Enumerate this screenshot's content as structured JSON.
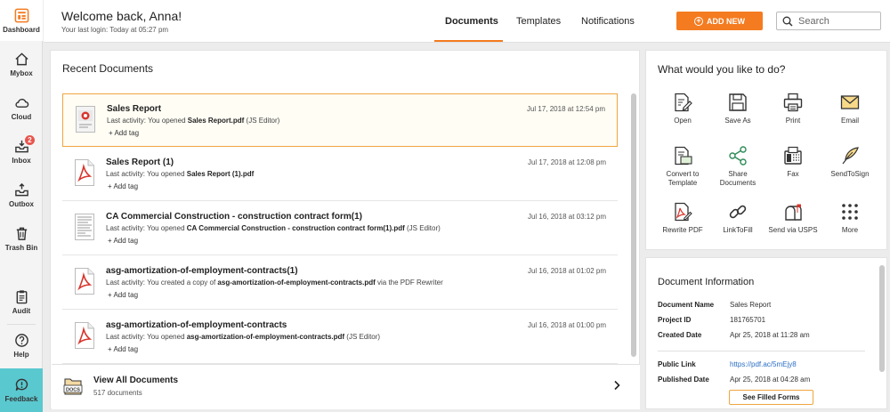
{
  "sidebar": {
    "items": [
      {
        "label": "Dashboard",
        "icon": "dashboard-icon"
      },
      {
        "label": "Mybox",
        "icon": "home-icon"
      },
      {
        "label": "Cloud",
        "icon": "cloud-icon"
      },
      {
        "label": "Inbox",
        "icon": "inbox-icon",
        "badge": "2"
      },
      {
        "label": "Outbox",
        "icon": "outbox-icon"
      },
      {
        "label": "Trash Bin",
        "icon": "trash-icon"
      },
      {
        "label": "Audit",
        "icon": "clipboard-icon"
      },
      {
        "label": "Help",
        "icon": "help-icon"
      },
      {
        "label": "Feedback",
        "icon": "feedback-icon"
      }
    ]
  },
  "header": {
    "welcome": "Welcome back, Anna!",
    "last_login": "Your last login: Today at 05:27 pm",
    "tabs": [
      {
        "label": "Documents",
        "active": true
      },
      {
        "label": "Templates",
        "active": false
      },
      {
        "label": "Notifications",
        "active": false
      }
    ],
    "add_new_label": "ADD NEW",
    "search_placeholder": "Search"
  },
  "recent": {
    "title": "Recent Documents",
    "documents": [
      {
        "name": "Sales Report",
        "activity_prefix": "Last activity: You opened ",
        "file": "Sales Report.pdf",
        "activity_suffix": " (JS Editor)",
        "date": "Jul 17, 2018 at 12:54 pm",
        "add_tag": "+ Add tag",
        "thumb": "report-thumbnail"
      },
      {
        "name": "Sales Report (1)",
        "activity_prefix": "Last activity: You opened ",
        "file": "Sales Report (1).pdf",
        "activity_suffix": "",
        "date": "Jul 17, 2018 at 12:08 pm",
        "add_tag": "+ Add tag",
        "thumb": "pdf-icon"
      },
      {
        "name": "CA Commercial Construction - construction contract form(1)",
        "activity_prefix": "Last activity: You opened ",
        "file": "CA Commercial Construction - construction contract form(1).pdf",
        "activity_suffix": " (JS Editor)",
        "date": "Jul 16, 2018 at 03:12 pm",
        "add_tag": "+ Add tag",
        "thumb": "form-thumbnail"
      },
      {
        "name": "asg-amortization-of-employment-contracts(1)",
        "activity_prefix": "Last activity: You created a copy of ",
        "file": "asg-amortization-of-employment-contracts.pdf",
        "activity_suffix": " via the PDF Rewriter",
        "date": "Jul 16, 2018 at 01:02 pm",
        "add_tag": "+ Add tag",
        "thumb": "pdf-icon"
      },
      {
        "name": "asg-amortization-of-employment-contracts",
        "activity_prefix": "Last activity: You opened ",
        "file": "asg-amortization-of-employment-contracts.pdf",
        "activity_suffix": " (JS Editor)",
        "date": "Jul 16, 2018 at 01:00 pm",
        "add_tag": "+ Add tag",
        "thumb": "pdf-icon"
      }
    ],
    "view_all": {
      "title": "View All Documents",
      "count": "517 documents",
      "icon_text": "DOCS"
    }
  },
  "actions": {
    "title": "What would you like to do?",
    "items": [
      {
        "label": "Open",
        "icon": "edit-document-icon"
      },
      {
        "label": "Save As",
        "icon": "floppy-disk-icon"
      },
      {
        "label": "Print",
        "icon": "printer-icon"
      },
      {
        "label": "Email",
        "icon": "envelope-icon"
      },
      {
        "label": "Convert to Template",
        "icon": "template-icon"
      },
      {
        "label": "Share Documents",
        "icon": "share-icon"
      },
      {
        "label": "Fax",
        "icon": "fax-icon"
      },
      {
        "label": "SendToSign",
        "icon": "feather-pen-icon"
      },
      {
        "label": "Rewrite PDF",
        "icon": "rewrite-pdf-icon"
      },
      {
        "label": "LinkToFill",
        "icon": "chain-link-icon"
      },
      {
        "label": "Send via USPS",
        "icon": "mailbox-icon"
      },
      {
        "label": "More",
        "icon": "more-dots-icon"
      }
    ]
  },
  "doc_info": {
    "title": "Document Information",
    "rows": [
      {
        "key": "Document Name",
        "value": "Sales Report"
      },
      {
        "key": "Project ID",
        "value": "181765701"
      },
      {
        "key": "Created Date",
        "value": "Apr 25, 2018 at 11:28 am"
      }
    ],
    "rows2": [
      {
        "key": "Public Link",
        "value": "https://pdf.ac/5mEjy8"
      },
      {
        "key": "Published Date",
        "value": "Apr 25, 2018 at 04:28 am"
      }
    ],
    "filled_forms_label": "See Filled Forms"
  },
  "colors": {
    "accent": "#f47b20",
    "feedback": "#5ac8cf",
    "link": "#2a6dc5",
    "pdf_red": "#d9332b"
  }
}
